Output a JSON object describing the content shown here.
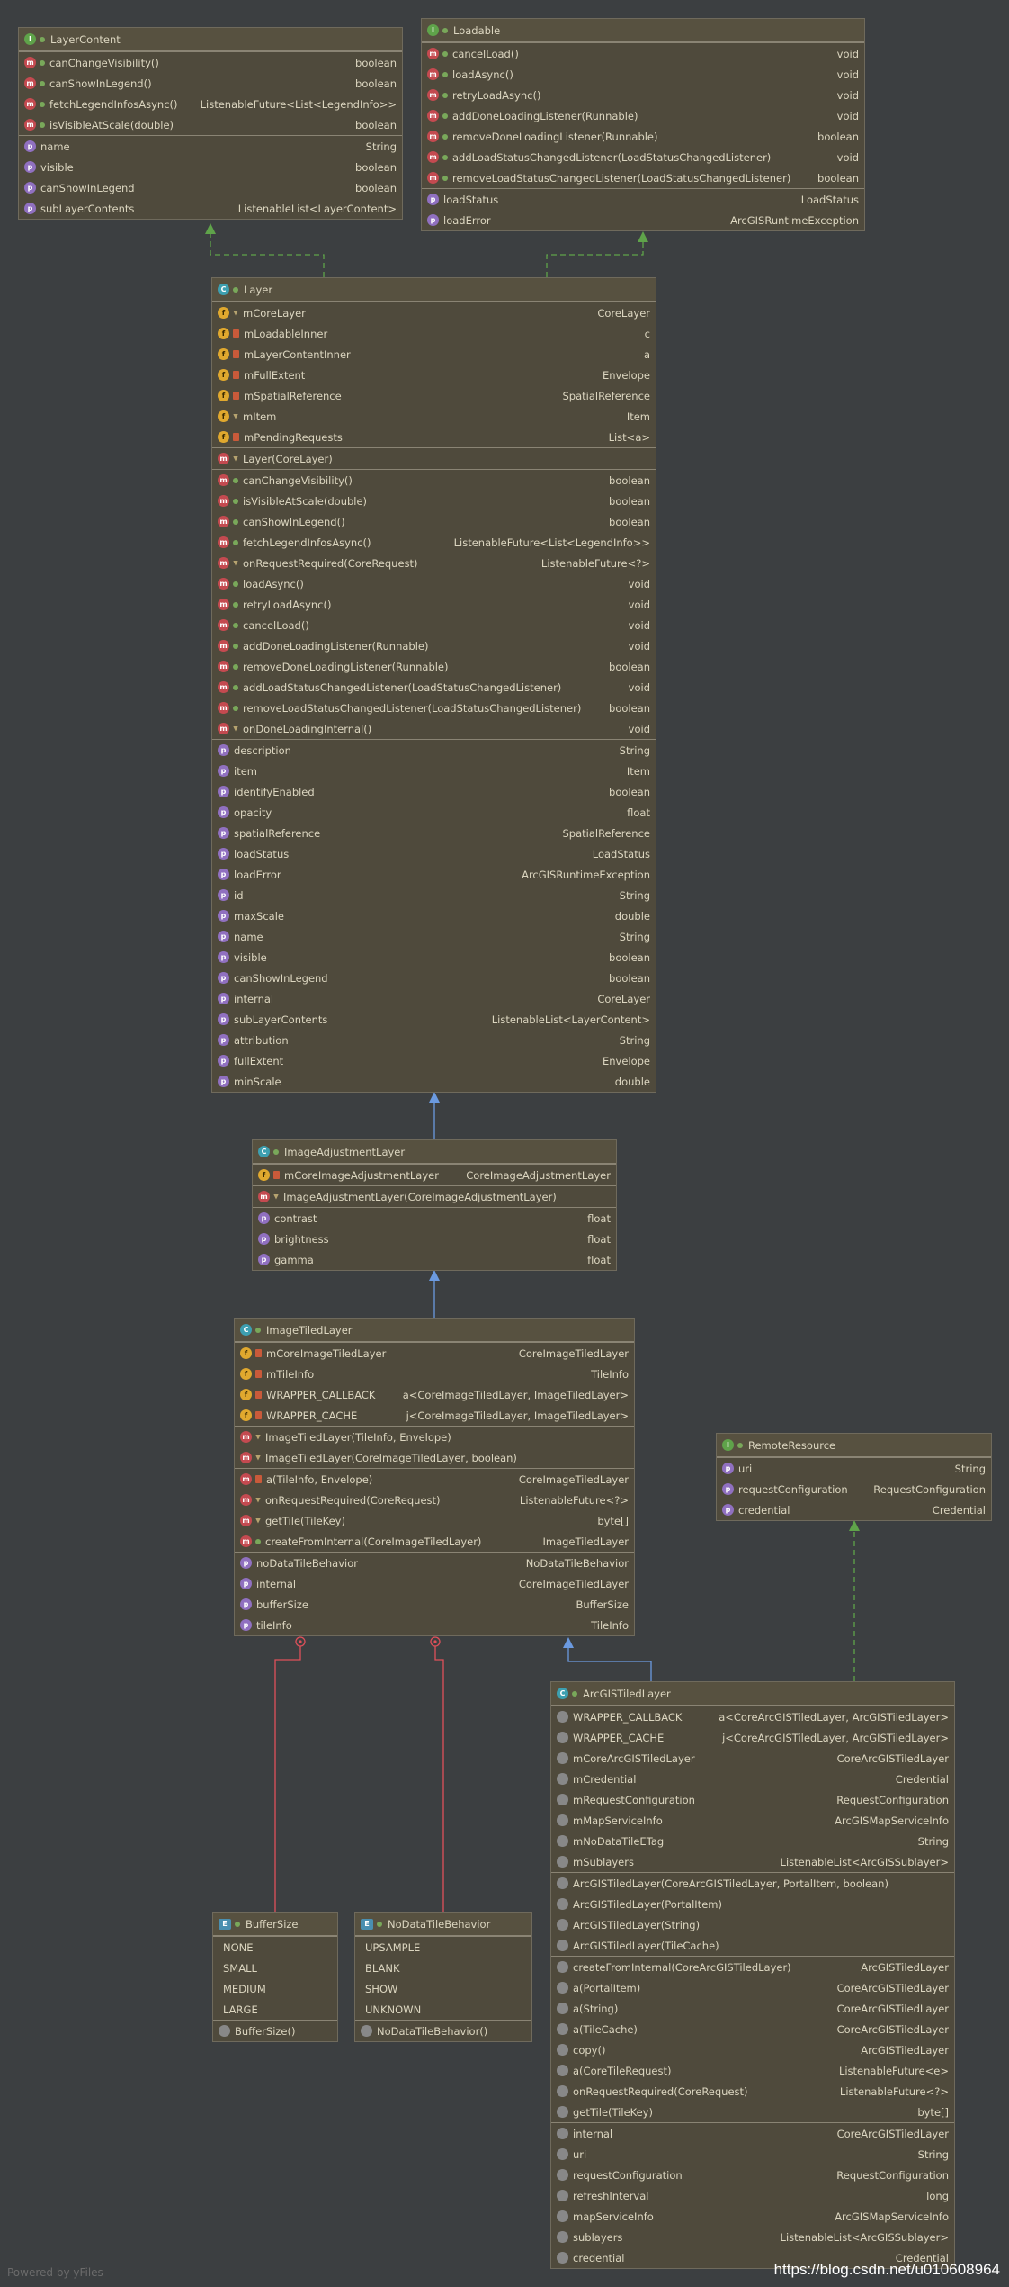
{
  "watermark": "Powered by yFiles",
  "url": "https://blog.csdn.net/u010608964",
  "colors": {
    "background": "#3c3f41",
    "node": "#4f4a3c",
    "inheritance": "#6b9ae0",
    "implements": "#5fa34a",
    "nested": "#e0505a"
  },
  "nodes": {
    "layercontent": {
      "icon": "interface-icon",
      "title": "LayerContent",
      "sections": [
        [
          {
            "k": "m",
            "mod": "pub",
            "name": "canChangeVisibility()",
            "type": "boolean"
          },
          {
            "k": "m",
            "mod": "pub",
            "name": "canShowInLegend()",
            "type": "boolean"
          },
          {
            "k": "m",
            "mod": "pub",
            "name": "fetchLegendInfosAsync()",
            "type": "ListenableFuture<List<LegendInfo>>"
          },
          {
            "k": "m",
            "mod": "pub",
            "name": "isVisibleAtScale(double)",
            "type": "boolean"
          }
        ],
        [
          {
            "k": "p",
            "name": "name",
            "type": "String"
          },
          {
            "k": "p",
            "name": "visible",
            "type": "boolean"
          },
          {
            "k": "p",
            "name": "canShowInLegend",
            "type": "boolean"
          },
          {
            "k": "p",
            "name": "subLayerContents",
            "type": "ListenableList<LayerContent>"
          }
        ]
      ]
    },
    "loadable": {
      "icon": "interface-icon",
      "title": "Loadable",
      "sections": [
        [
          {
            "k": "m",
            "mod": "pub",
            "name": "cancelLoad()",
            "type": "void"
          },
          {
            "k": "m",
            "mod": "pub",
            "name": "loadAsync()",
            "type": "void"
          },
          {
            "k": "m",
            "mod": "pub",
            "name": "retryLoadAsync()",
            "type": "void"
          },
          {
            "k": "m",
            "mod": "pub",
            "name": "addDoneLoadingListener(Runnable)",
            "type": "void"
          },
          {
            "k": "m",
            "mod": "pub",
            "name": "removeDoneLoadingListener(Runnable)",
            "type": "boolean"
          },
          {
            "k": "m",
            "mod": "pub",
            "name": "addLoadStatusChangedListener(LoadStatusChangedListener)",
            "type": "void"
          },
          {
            "k": "m",
            "mod": "pub",
            "name": "removeLoadStatusChangedListener(LoadStatusChangedListener)",
            "type": "boolean"
          }
        ],
        [
          {
            "k": "p",
            "name": "loadStatus",
            "type": "LoadStatus"
          },
          {
            "k": "p",
            "name": "loadError",
            "type": "ArcGISRuntimeException"
          }
        ]
      ]
    },
    "layer": {
      "icon": "abstract-class-icon",
      "title": "Layer",
      "sections": [
        [
          {
            "k": "f",
            "mod": "pkg",
            "name": "mCoreLayer",
            "type": "CoreLayer"
          },
          {
            "k": "f",
            "mod": "prv",
            "name": "mLoadableInner",
            "type": "c"
          },
          {
            "k": "f",
            "mod": "prv",
            "name": "mLayerContentInner",
            "type": "a"
          },
          {
            "k": "f",
            "mod": "prv",
            "name": "mFullExtent",
            "type": "Envelope"
          },
          {
            "k": "f",
            "mod": "prv",
            "name": "mSpatialReference",
            "type": "SpatialReference"
          },
          {
            "k": "f",
            "mod": "pkg",
            "name": "mItem",
            "type": "Item"
          },
          {
            "k": "f",
            "mod": "prv",
            "name": "mPendingRequests",
            "type": "List<a>"
          }
        ],
        [
          {
            "k": "m",
            "mod": "pkg",
            "name": "Layer(CoreLayer)",
            "type": ""
          }
        ],
        [
          {
            "k": "m",
            "mod": "pub",
            "name": "canChangeVisibility()",
            "type": "boolean"
          },
          {
            "k": "m",
            "mod": "pub",
            "name": "isVisibleAtScale(double)",
            "type": "boolean"
          },
          {
            "k": "m",
            "mod": "pub",
            "name": "canShowInLegend()",
            "type": "boolean"
          },
          {
            "k": "m",
            "mod": "pub",
            "name": "fetchLegendInfosAsync()",
            "type": "ListenableFuture<List<LegendInfo>>"
          },
          {
            "k": "m",
            "mod": "pkg",
            "name": "onRequestRequired(CoreRequest)",
            "type": "ListenableFuture<?>"
          },
          {
            "k": "m",
            "mod": "pub",
            "name": "loadAsync()",
            "type": "void"
          },
          {
            "k": "m",
            "mod": "pub",
            "name": "retryLoadAsync()",
            "type": "void"
          },
          {
            "k": "m",
            "mod": "pub",
            "name": "cancelLoad()",
            "type": "void"
          },
          {
            "k": "m",
            "mod": "pub",
            "name": "addDoneLoadingListener(Runnable)",
            "type": "void"
          },
          {
            "k": "m",
            "mod": "pub",
            "name": "removeDoneLoadingListener(Runnable)",
            "type": "boolean"
          },
          {
            "k": "m",
            "mod": "pub",
            "name": "addLoadStatusChangedListener(LoadStatusChangedListener)",
            "type": "void"
          },
          {
            "k": "m",
            "mod": "pub",
            "name": "removeLoadStatusChangedListener(LoadStatusChangedListener)",
            "type": "boolean"
          },
          {
            "k": "m",
            "mod": "pkg",
            "name": "onDoneLoadingInternal()",
            "type": "void"
          }
        ],
        [
          {
            "k": "p",
            "name": "description",
            "type": "String"
          },
          {
            "k": "p",
            "name": "item",
            "type": "Item"
          },
          {
            "k": "p",
            "name": "identifyEnabled",
            "type": "boolean"
          },
          {
            "k": "p",
            "name": "opacity",
            "type": "float"
          },
          {
            "k": "p",
            "name": "spatialReference",
            "type": "SpatialReference"
          },
          {
            "k": "p",
            "name": "loadStatus",
            "type": "LoadStatus"
          },
          {
            "k": "p",
            "name": "loadError",
            "type": "ArcGISRuntimeException"
          },
          {
            "k": "p",
            "name": "id",
            "type": "String"
          },
          {
            "k": "p",
            "name": "maxScale",
            "type": "double"
          },
          {
            "k": "p",
            "name": "name",
            "type": "String"
          },
          {
            "k": "p",
            "name": "visible",
            "type": "boolean"
          },
          {
            "k": "p",
            "name": "canShowInLegend",
            "type": "boolean"
          },
          {
            "k": "p",
            "name": "internal",
            "type": "CoreLayer"
          },
          {
            "k": "p",
            "name": "subLayerContents",
            "type": "ListenableList<LayerContent>"
          },
          {
            "k": "p",
            "name": "attribution",
            "type": "String"
          },
          {
            "k": "p",
            "name": "fullExtent",
            "type": "Envelope"
          },
          {
            "k": "p",
            "name": "minScale",
            "type": "double"
          }
        ]
      ]
    },
    "imageadj": {
      "icon": "abstract-class-icon",
      "title": "ImageAdjustmentLayer",
      "sections": [
        [
          {
            "k": "f",
            "mod": "prv",
            "name": "mCoreImageAdjustmentLayer",
            "type": "CoreImageAdjustmentLayer"
          }
        ],
        [
          {
            "k": "m",
            "mod": "pkg",
            "name": "ImageAdjustmentLayer(CoreImageAdjustmentLayer)",
            "type": ""
          }
        ],
        [
          {
            "k": "p",
            "name": "contrast",
            "type": "float"
          },
          {
            "k": "p",
            "name": "brightness",
            "type": "float"
          },
          {
            "k": "p",
            "name": "gamma",
            "type": "float"
          }
        ]
      ]
    },
    "imagetiled": {
      "icon": "abstract-class-icon",
      "title": "ImageTiledLayer",
      "sections": [
        [
          {
            "k": "f",
            "mod": "prv",
            "name": "mCoreImageTiledLayer",
            "type": "CoreImageTiledLayer"
          },
          {
            "k": "f",
            "mod": "prv",
            "name": "mTileInfo",
            "type": "TileInfo"
          },
          {
            "k": "f",
            "mod": "prv",
            "name": "WRAPPER_CALLBACK",
            "type": "a<CoreImageTiledLayer, ImageTiledLayer>"
          },
          {
            "k": "f",
            "mod": "prv",
            "name": "WRAPPER_CACHE",
            "type": "j<CoreImageTiledLayer, ImageTiledLayer>"
          }
        ],
        [
          {
            "k": "m",
            "mod": "pkg",
            "name": "ImageTiledLayer(TileInfo, Envelope)",
            "type": ""
          },
          {
            "k": "m",
            "mod": "pkg",
            "name": "ImageTiledLayer(CoreImageTiledLayer, boolean)",
            "type": ""
          }
        ],
        [
          {
            "k": "m",
            "mod": "prv",
            "name": "a(TileInfo, Envelope)",
            "type": "CoreImageTiledLayer"
          },
          {
            "k": "m",
            "mod": "pkg",
            "name": "onRequestRequired(CoreRequest)",
            "type": "ListenableFuture<?>"
          },
          {
            "k": "m",
            "mod": "pkg",
            "name": "getTile(TileKey)",
            "type": "byte[]"
          },
          {
            "k": "m",
            "mod": "pub",
            "name": "createFromInternal(CoreImageTiledLayer)",
            "type": "ImageTiledLayer"
          }
        ],
        [
          {
            "k": "p",
            "name": "noDataTileBehavior",
            "type": "NoDataTileBehavior"
          },
          {
            "k": "p",
            "name": "internal",
            "type": "CoreImageTiledLayer"
          },
          {
            "k": "p",
            "name": "bufferSize",
            "type": "BufferSize"
          },
          {
            "k": "p",
            "name": "tileInfo",
            "type": "TileInfo"
          }
        ]
      ]
    },
    "remote": {
      "icon": "interface-icon",
      "title": "RemoteResource",
      "sections": [
        [
          {
            "k": "p",
            "name": "uri",
            "type": "String"
          },
          {
            "k": "p",
            "name": "requestConfiguration",
            "type": "RequestConfiguration"
          },
          {
            "k": "p",
            "name": "credential",
            "type": "Credential"
          }
        ]
      ]
    },
    "arcgis": {
      "icon": "class-icon",
      "title": "ArcGISTiledLayer",
      "sections": [
        [
          {
            "k": "lk",
            "name": "WRAPPER_CALLBACK",
            "type": "a<CoreArcGISTiledLayer, ArcGISTiledLayer>"
          },
          {
            "k": "lk",
            "name": "WRAPPER_CACHE",
            "type": "j<CoreArcGISTiledLayer, ArcGISTiledLayer>"
          },
          {
            "k": "lk",
            "name": "mCoreArcGISTiledLayer",
            "type": "CoreArcGISTiledLayer"
          },
          {
            "k": "lk",
            "name": "mCredential",
            "type": "Credential"
          },
          {
            "k": "lk",
            "name": "mRequestConfiguration",
            "type": "RequestConfiguration"
          },
          {
            "k": "lk",
            "name": "mMapServiceInfo",
            "type": "ArcGISMapServiceInfo"
          },
          {
            "k": "lk",
            "name": "mNoDataTileETag",
            "type": "String"
          },
          {
            "k": "lk",
            "name": "mSublayers",
            "type": "ListenableList<ArcGISSublayer>"
          }
        ],
        [
          {
            "k": "lk",
            "name": "ArcGISTiledLayer(CoreArcGISTiledLayer, PortalItem, boolean)",
            "type": ""
          },
          {
            "k": "lk",
            "name": "ArcGISTiledLayer(PortalItem)",
            "type": ""
          },
          {
            "k": "lk",
            "name": "ArcGISTiledLayer(String)",
            "type": ""
          },
          {
            "k": "lk",
            "name": "ArcGISTiledLayer(TileCache)",
            "type": ""
          }
        ],
        [
          {
            "k": "lk",
            "name": "createFromInternal(CoreArcGISTiledLayer)",
            "type": "ArcGISTiledLayer"
          },
          {
            "k": "lk",
            "name": "a(PortalItem)",
            "type": "CoreArcGISTiledLayer"
          },
          {
            "k": "lk",
            "name": "a(String)",
            "type": "CoreArcGISTiledLayer"
          },
          {
            "k": "lk",
            "name": "a(TileCache)",
            "type": "CoreArcGISTiledLayer"
          },
          {
            "k": "lk",
            "name": "copy()",
            "type": "ArcGISTiledLayer"
          },
          {
            "k": "lk",
            "name": "a(CoreTileRequest)",
            "type": "ListenableFuture<e>"
          },
          {
            "k": "lk",
            "name": "onRequestRequired(CoreRequest)",
            "type": "ListenableFuture<?>"
          },
          {
            "k": "lk",
            "name": "getTile(TileKey)",
            "type": "byte[]"
          }
        ],
        [
          {
            "k": "lk",
            "name": "internal",
            "type": "CoreArcGISTiledLayer"
          },
          {
            "k": "lk",
            "name": "uri",
            "type": "String"
          },
          {
            "k": "lk",
            "name": "requestConfiguration",
            "type": "RequestConfiguration"
          },
          {
            "k": "lk",
            "name": "refreshInterval",
            "type": "long"
          },
          {
            "k": "lk",
            "name": "mapServiceInfo",
            "type": "ArcGISMapServiceInfo"
          },
          {
            "k": "lk",
            "name": "sublayers",
            "type": "ListenableList<ArcGISSublayer>"
          },
          {
            "k": "lk",
            "name": "credential",
            "type": "Credential"
          }
        ]
      ]
    },
    "buffersize": {
      "icon": "enum-icon",
      "title": "BufferSize",
      "sections": [
        [
          {
            "k": "x",
            "name": "NONE",
            "type": ""
          },
          {
            "k": "x",
            "name": "SMALL",
            "type": ""
          },
          {
            "k": "x",
            "name": "MEDIUM",
            "type": ""
          },
          {
            "k": "x",
            "name": "LARGE",
            "type": ""
          }
        ],
        [
          {
            "k": "lk",
            "name": "BufferSize()",
            "type": ""
          }
        ]
      ]
    },
    "nodata": {
      "icon": "enum-icon",
      "title": "NoDataTileBehavior",
      "sections": [
        [
          {
            "k": "x",
            "name": "UPSAMPLE",
            "type": ""
          },
          {
            "k": "x",
            "name": "BLANK",
            "type": ""
          },
          {
            "k": "x",
            "name": "SHOW",
            "type": ""
          },
          {
            "k": "x",
            "name": "UNKNOWN",
            "type": ""
          }
        ],
        [
          {
            "k": "lk",
            "name": "NoDataTileBehavior()",
            "type": ""
          }
        ]
      ]
    }
  }
}
